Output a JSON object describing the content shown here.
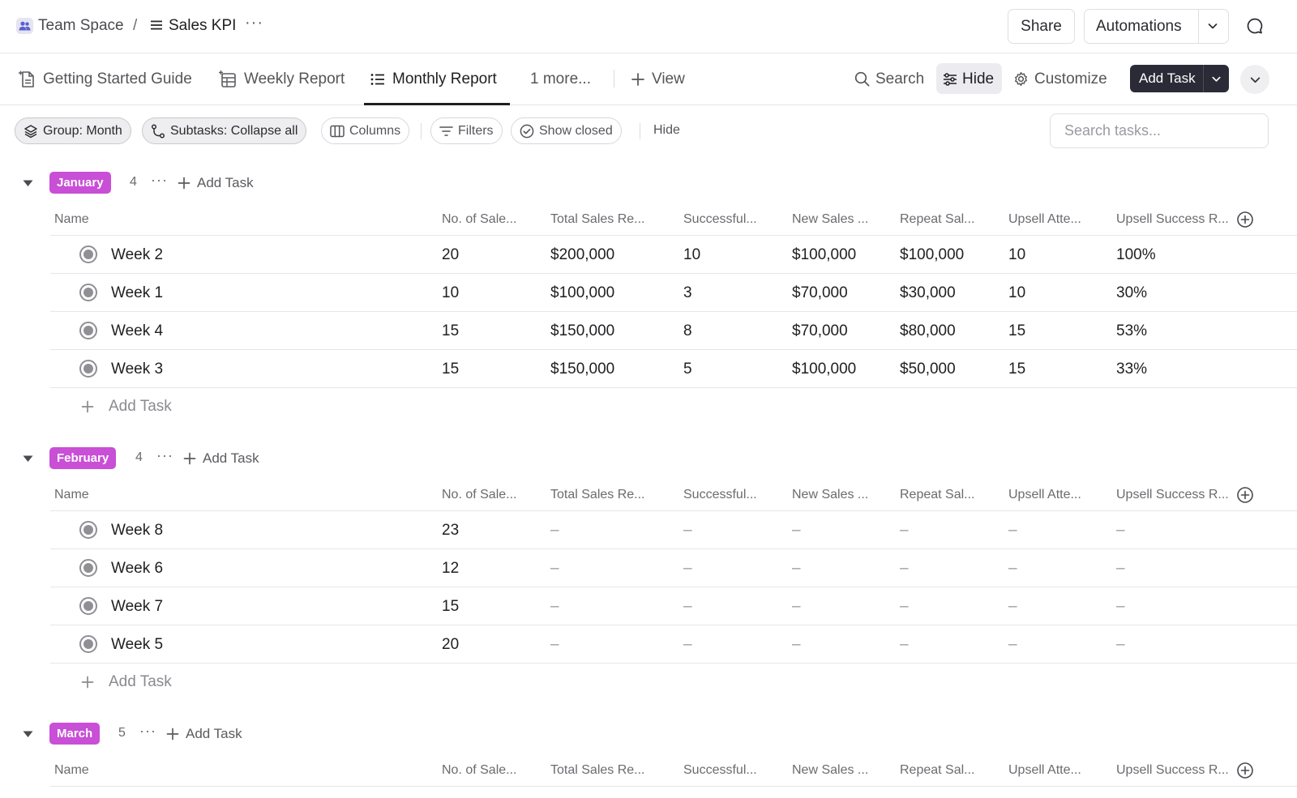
{
  "breadcrumb": {
    "space": "Team Space",
    "separator": "/",
    "list": "Sales KPI",
    "more": "···"
  },
  "header_actions": {
    "share": "Share",
    "automations": "Automations"
  },
  "tabs": [
    {
      "label": "Getting Started Guide",
      "icon": "doc-icon"
    },
    {
      "label": "Weekly Report",
      "icon": "table-icon"
    },
    {
      "label": "Monthly Report",
      "icon": "list-icon",
      "active": true
    },
    {
      "label": "1 more..."
    },
    {
      "label": "View",
      "icon": "plus-icon"
    }
  ],
  "toolbar": {
    "search": "Search",
    "hide": "Hide",
    "customize": "Customize",
    "add_task": "Add Task"
  },
  "filters": {
    "group": "Group: Month",
    "subtasks": "Subtasks: Collapse all",
    "columns": "Columns",
    "filters": "Filters",
    "show_closed": "Show closed",
    "hide": "Hide",
    "search_placeholder": "Search tasks..."
  },
  "columns": [
    "Name",
    "No. of Sale...",
    "Total Sales Re...",
    "Successful...",
    "New Sales ...",
    "Repeat Sal...",
    "Upsell Atte...",
    "Upsell Success R..."
  ],
  "add_task_label": "Add Task",
  "groups": [
    {
      "name": "January",
      "count": "4",
      "dots": "···",
      "rows": [
        [
          "Week 2",
          "20",
          "$200,000",
          "10",
          "$100,000",
          "$100,000",
          "10",
          "100%"
        ],
        [
          "Week 1",
          "10",
          "$100,000",
          "3",
          "$70,000",
          "$30,000",
          "10",
          "30%"
        ],
        [
          "Week 4",
          "15",
          "$150,000",
          "8",
          "$70,000",
          "$80,000",
          "15",
          "53%"
        ],
        [
          "Week 3",
          "15",
          "$150,000",
          "5",
          "$100,000",
          "$50,000",
          "15",
          "33%"
        ]
      ]
    },
    {
      "name": "February",
      "count": "4",
      "dots": "···",
      "rows": [
        [
          "Week 8",
          "23",
          "–",
          "–",
          "–",
          "–",
          "–",
          "–"
        ],
        [
          "Week 6",
          "12",
          "–",
          "–",
          "–",
          "–",
          "–",
          "–"
        ],
        [
          "Week 7",
          "15",
          "–",
          "–",
          "–",
          "–",
          "–",
          "–"
        ],
        [
          "Week 5",
          "20",
          "–",
          "–",
          "–",
          "–",
          "–",
          "–"
        ]
      ]
    },
    {
      "name": "March",
      "count": "5",
      "dots": "···",
      "rows": []
    }
  ],
  "colors": {
    "badge": "#c84fd6",
    "primary_button": "#2a2b36",
    "status_gray": "#8f8f95"
  }
}
